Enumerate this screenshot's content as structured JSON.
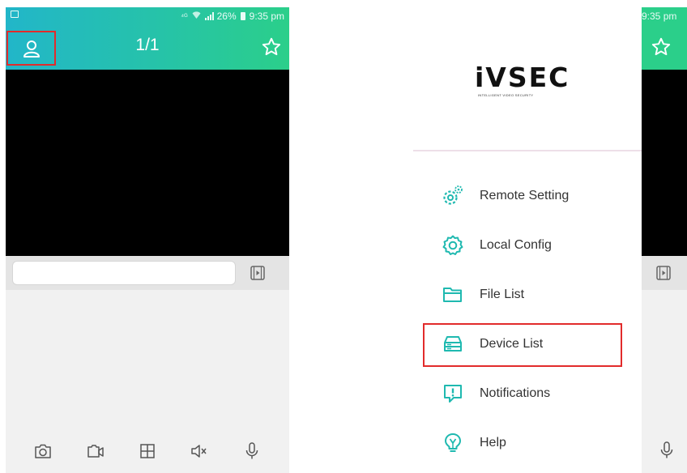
{
  "left_screen": {
    "status_bar": {
      "battery": "26%",
      "time": "9:35 pm"
    },
    "header": {
      "page_counter": "1/1"
    },
    "toolbar": {
      "items": [
        {
          "icon": "camera-icon"
        },
        {
          "icon": "record-icon"
        },
        {
          "icon": "grid-icon"
        },
        {
          "icon": "mute-icon"
        },
        {
          "icon": "microphone-icon"
        }
      ]
    }
  },
  "drawer": {
    "logo": {
      "text": "iVSEC",
      "tagline": "INTELLIGENT VIDEO SECURITY"
    },
    "menu": [
      {
        "label": "Remote Setting",
        "icon": "remote-gear-icon"
      },
      {
        "label": "Local Config",
        "icon": "gear-icon"
      },
      {
        "label": "File List",
        "icon": "folder-icon"
      },
      {
        "label": "Device List",
        "icon": "device-icon",
        "highlighted": true
      },
      {
        "label": "Notifications",
        "icon": "notification-icon"
      },
      {
        "label": "Help",
        "icon": "help-icon"
      }
    ]
  },
  "right_screen": {
    "status_bar": {
      "time": "9:35 pm"
    }
  },
  "colors": {
    "header_gradient_start": "#22b6c9",
    "header_gradient_end": "#2bcf8a",
    "accent_teal": "#1fb9b0",
    "highlight_red": "#e22b2b"
  }
}
